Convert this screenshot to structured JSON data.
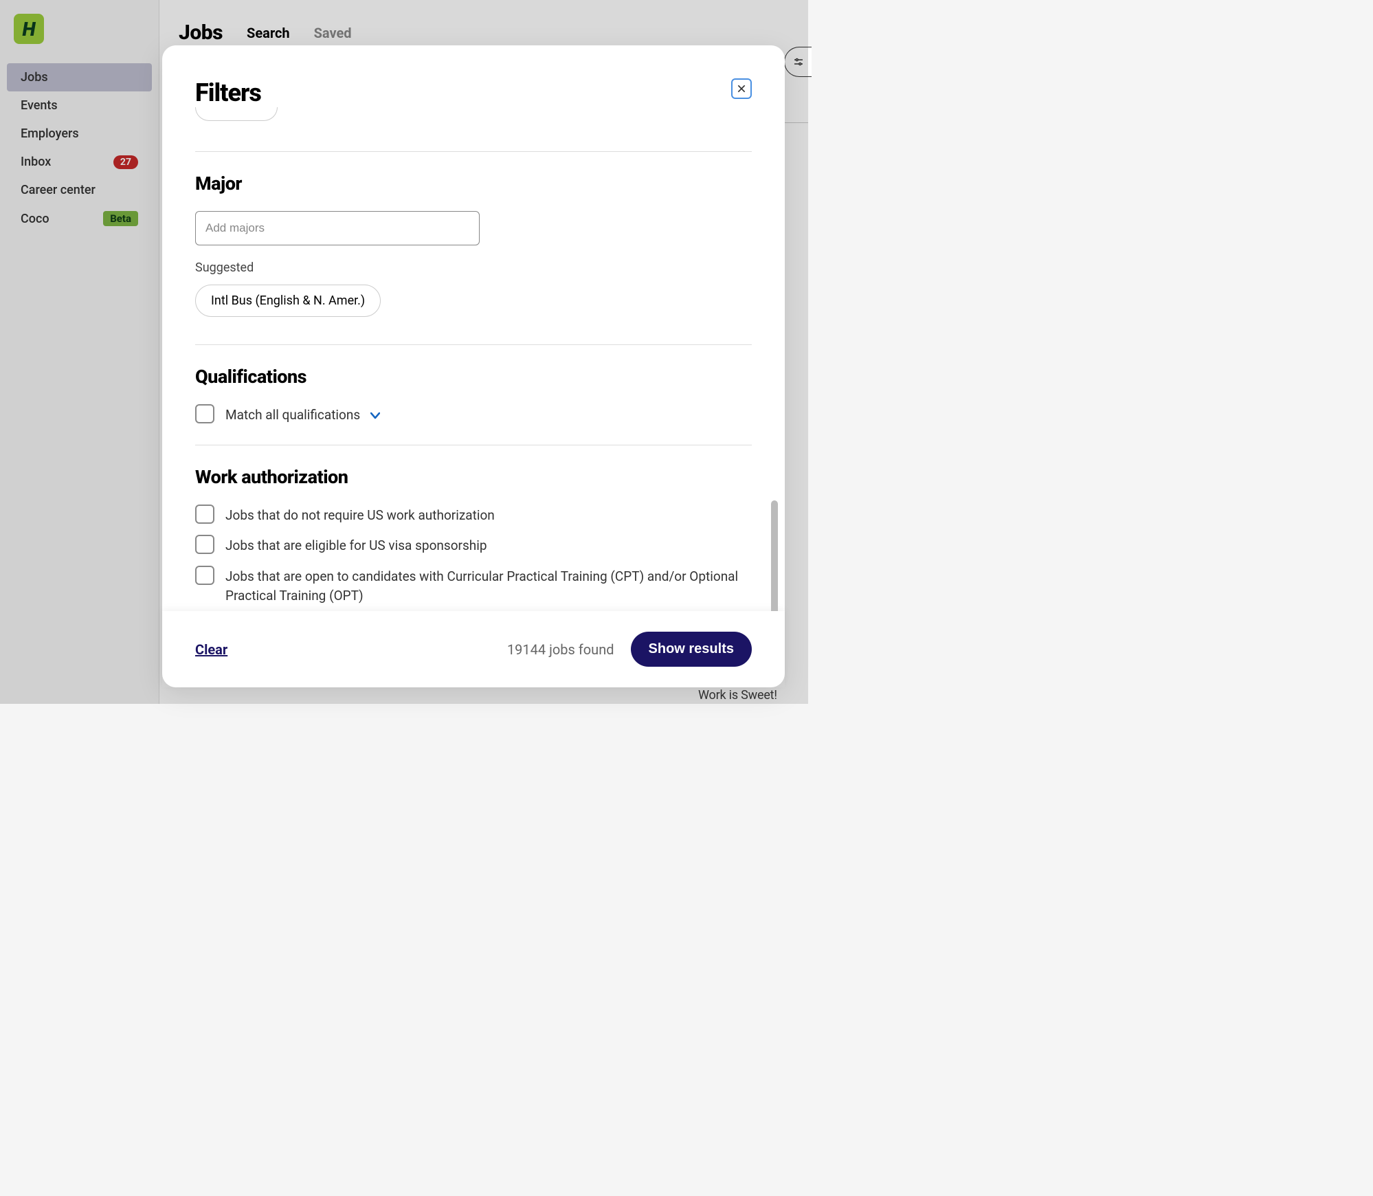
{
  "logo_letter": "H",
  "sidebar": {
    "items": [
      {
        "label": "Jobs",
        "active": true
      },
      {
        "label": "Events"
      },
      {
        "label": "Employers"
      },
      {
        "label": "Inbox",
        "badge_count": "27"
      },
      {
        "label": "Career center"
      },
      {
        "label": "Coco",
        "badge_text": "Beta"
      }
    ]
  },
  "page": {
    "title": "Jobs",
    "tabs": [
      {
        "label": "Search",
        "active": true
      },
      {
        "label": "Saved"
      }
    ]
  },
  "modal": {
    "title": "Filters",
    "major": {
      "heading": "Major",
      "placeholder": "Add majors",
      "suggested_label": "Suggested",
      "suggested_pill": "Intl Bus (English & N. Amer.)"
    },
    "qualifications": {
      "heading": "Qualifications",
      "match_all_label": "Match all qualifications"
    },
    "work_auth": {
      "heading": "Work authorization",
      "options": [
        "Jobs that do not require US work authorization",
        "Jobs that are eligible for US visa sponsorship",
        "Jobs that are open to candidates with Curricular Practical Training (CPT) and/or Optional Practical Training (OPT)"
      ]
    },
    "footer": {
      "clear": "Clear",
      "count": "19144 jobs found",
      "button": "Show results"
    }
  },
  "bg_peek_text": "Work is Sweet!"
}
